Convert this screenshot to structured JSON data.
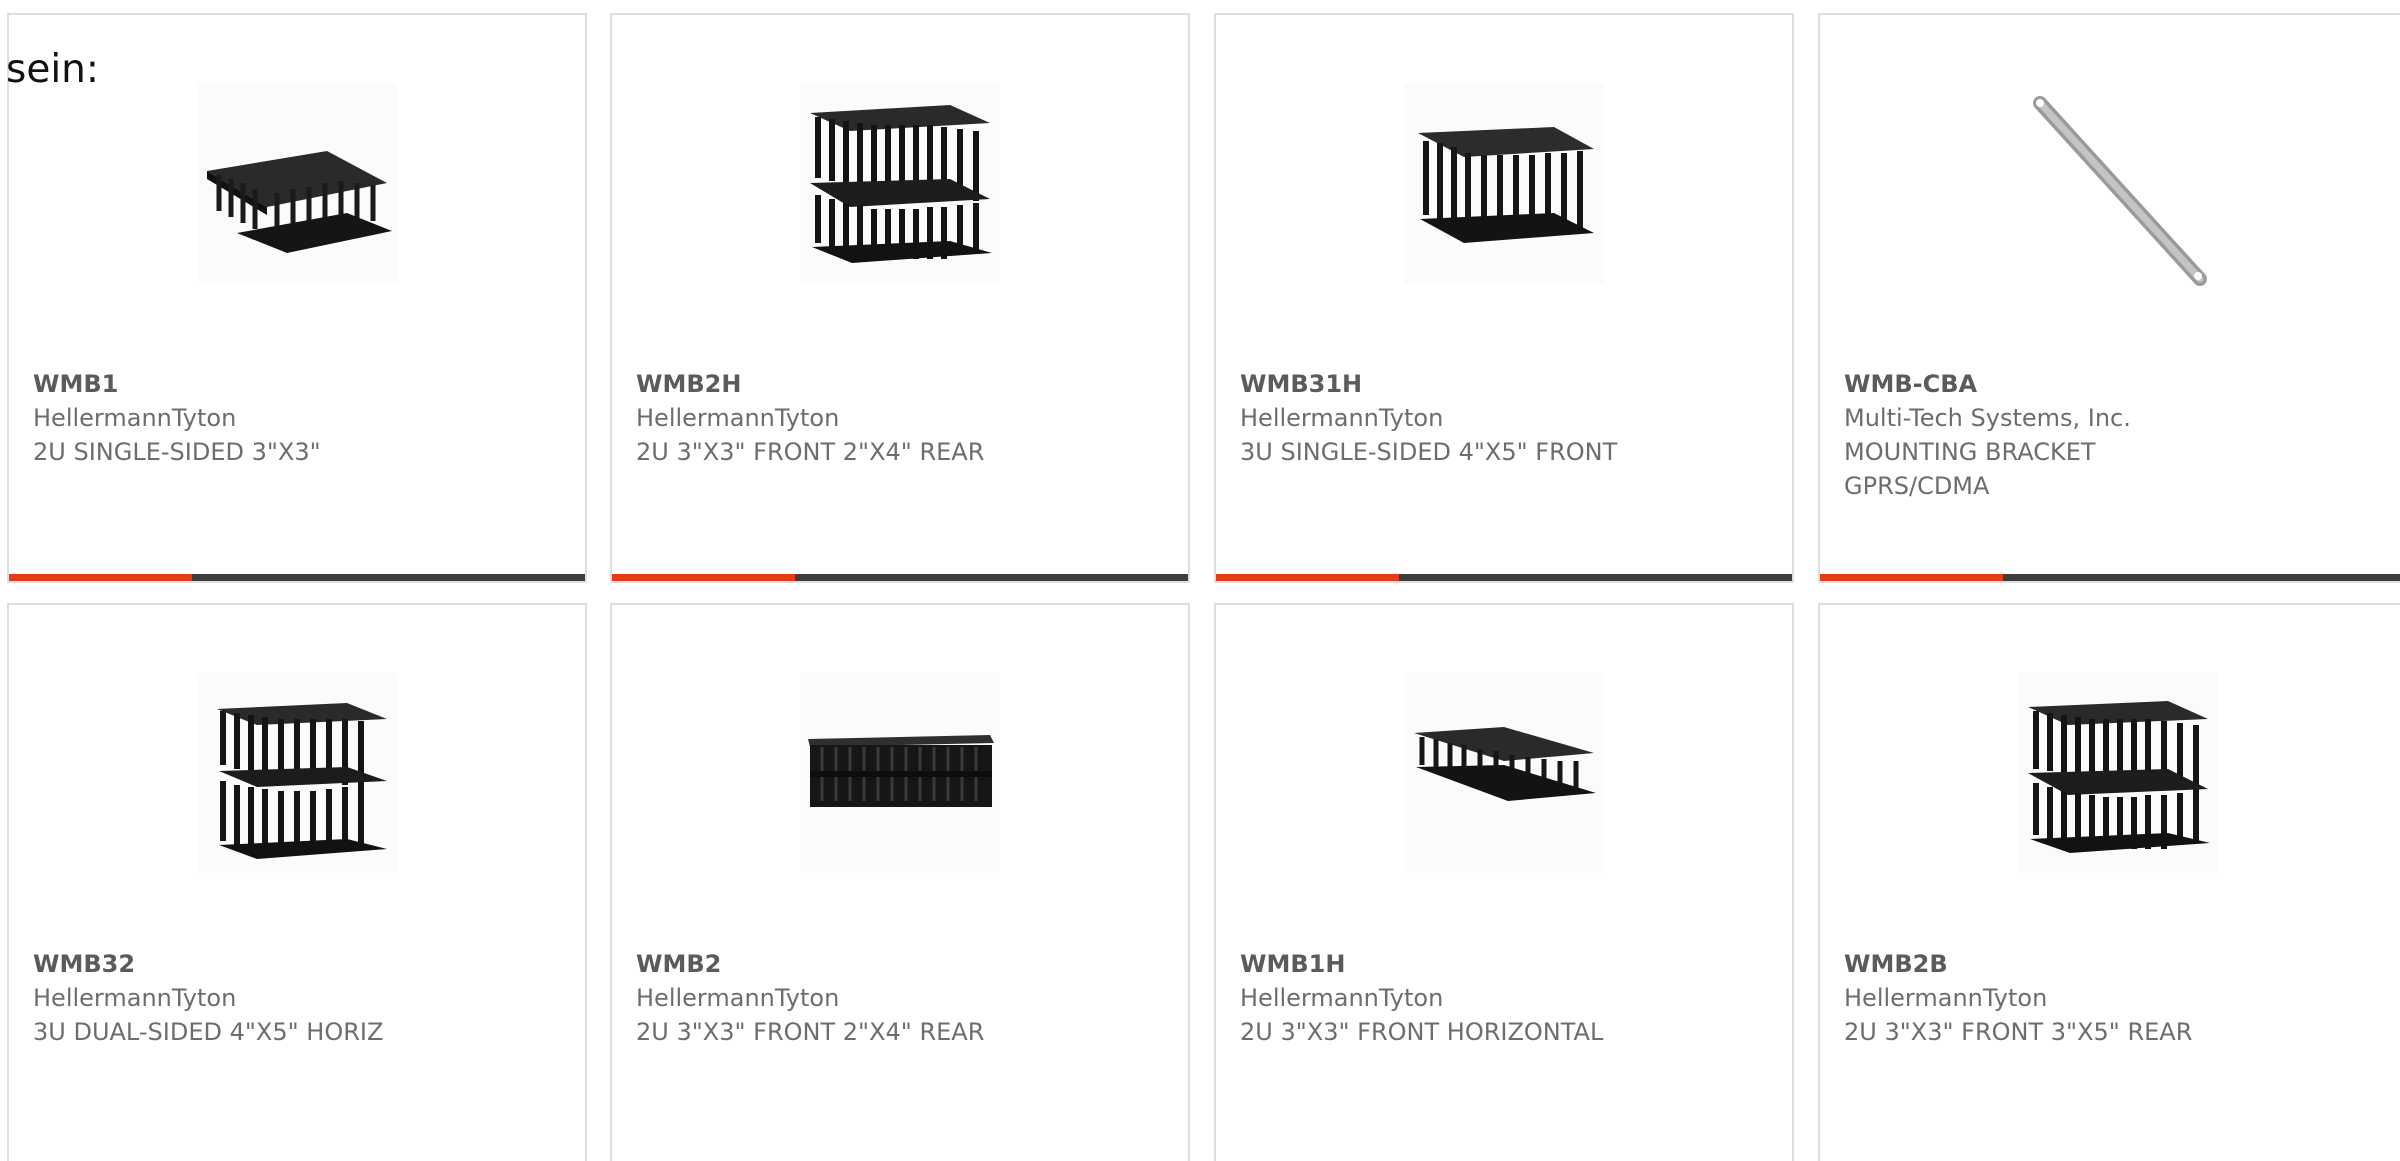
{
  "intro": "sein:",
  "accent_color": "#e33c16",
  "bar_color": "#3d3d3d",
  "products": [
    {
      "part": "WMB1",
      "manufacturer": "HellermannTyton",
      "description": "2U SINGLE-SIDED 3\"X3\"",
      "icon": "cable-manager-single-image"
    },
    {
      "part": "WMB2H",
      "manufacturer": "HellermannTyton",
      "description": "2U 3\"X3\" FRONT 2\"X4\" REAR",
      "icon": "cable-manager-dual-image"
    },
    {
      "part": "WMB31H",
      "manufacturer": "HellermannTyton",
      "description": "3U SINGLE-SIDED 4\"X5\" FRONT",
      "icon": "cable-manager-single-image"
    },
    {
      "part": "WMB-CBA",
      "manufacturer": "Multi-Tech Systems, Inc.",
      "description": "MOUNTING BRACKET GPRS/CDMA",
      "icon": "mounting-bracket-image"
    },
    {
      "part": "WMB32",
      "manufacturer": "HellermannTyton",
      "description": "3U DUAL-SIDED 4\"X5\" HORIZ",
      "icon": "cable-manager-dual-image"
    },
    {
      "part": "WMB2",
      "manufacturer": "HellermannTyton",
      "description": "2U 3\"X3\" FRONT 2\"X4\" REAR",
      "icon": "cable-manager-front-image"
    },
    {
      "part": "WMB1H",
      "manufacturer": "HellermannTyton",
      "description": "2U 3\"X3\" FRONT HORIZONTAL",
      "icon": "cable-manager-single-image"
    },
    {
      "part": "WMB2B",
      "manufacturer": "HellermannTyton",
      "description": "2U 3\"X3\" FRONT 3\"X5\" REAR",
      "icon": "cable-manager-dual-image"
    }
  ]
}
